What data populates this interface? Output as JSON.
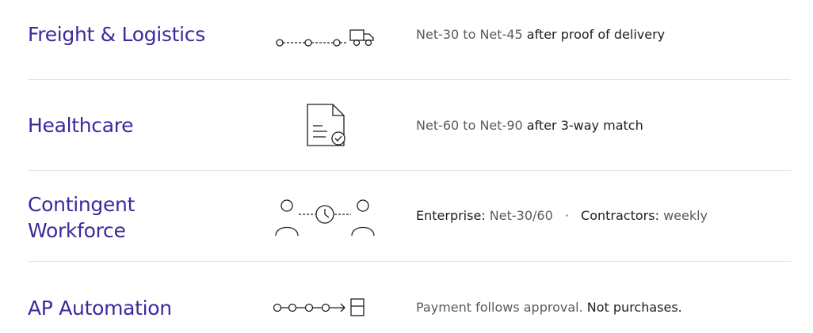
{
  "rows": [
    {
      "title": "Freight & Logistics",
      "icon": "truck-route-icon",
      "terms": "Net-30 to Net-45",
      "condition": "after proof of delivery"
    },
    {
      "title": "Healthcare",
      "icon": "document-check-icon",
      "terms": "Net-60 to Net-90",
      "condition": "after 3-way match"
    },
    {
      "title_line1": "Contingent",
      "title_line2": "Workforce",
      "icon": "people-clock-icon",
      "label_a": "Enterprise:",
      "value_a": "Net-30/60",
      "separator": "·",
      "label_b": "Contractors:",
      "value_b": "weekly"
    },
    {
      "title": "AP Automation",
      "icon": "workflow-payment-icon",
      "text_a": "Payment follows approval.",
      "text_b": "Not purchases."
    }
  ],
  "colors": {
    "title": "#3a2a9c",
    "muted": "#5a5a5a",
    "strong": "#1e1e1e",
    "divider": "#e4e4e4"
  }
}
